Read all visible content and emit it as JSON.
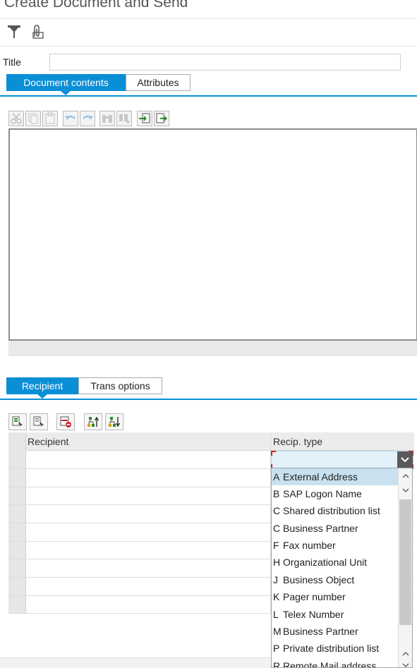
{
  "window": {
    "title": "Create Document and Send"
  },
  "toolbar": {
    "icons": [
      "send-icon",
      "attachment-icon"
    ]
  },
  "form": {
    "title_label": "Title",
    "title_value": ""
  },
  "tabs_top": [
    {
      "label": "Document contents",
      "active": true
    },
    {
      "label": "Attributes",
      "active": false
    }
  ],
  "tabs_bottom": [
    {
      "label": "Recipient",
      "active": true
    },
    {
      "label": "Trans options",
      "active": false
    }
  ],
  "recipient_table": {
    "columns": [
      "Recipient",
      "Recip. type"
    ],
    "row_count": 9
  },
  "dropdown": {
    "selected_value": "",
    "options": [
      {
        "key": "A",
        "label": "External Address"
      },
      {
        "key": "B",
        "label": "SAP Logon Name"
      },
      {
        "key": "C",
        "label": "Shared distribution list"
      },
      {
        "key": "C",
        "label": "Business Partner"
      },
      {
        "key": "F",
        "label": "Fax number"
      },
      {
        "key": "H",
        "label": "Organizational Unit"
      },
      {
        "key": "J",
        "label": "Business Object"
      },
      {
        "key": "K",
        "label": "Pager number"
      },
      {
        "key": "L",
        "label": "Telex Number"
      },
      {
        "key": "M",
        "label": "Business Partner"
      },
      {
        "key": "P",
        "label": "Private distribution list"
      },
      {
        "key": "R",
        "label": "Remote Mail address"
      }
    ]
  },
  "colors": {
    "accent": "#0a8fd7",
    "highlight": "#c9e1ef",
    "focus_corner": "#d6221d"
  }
}
